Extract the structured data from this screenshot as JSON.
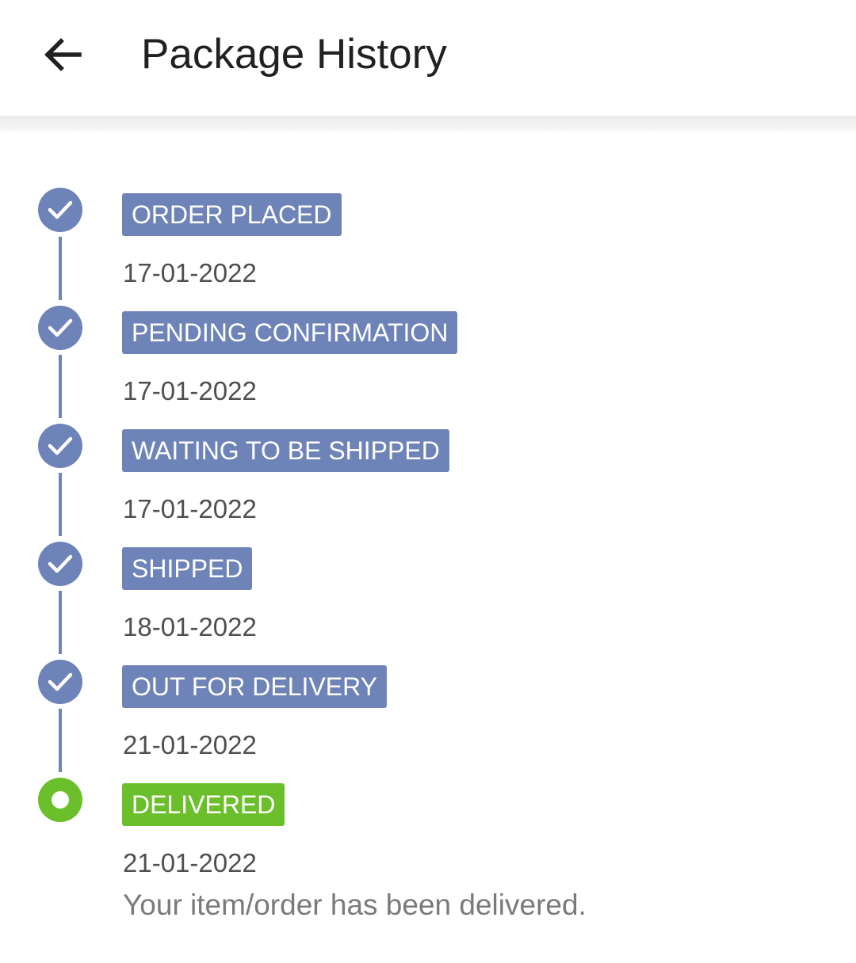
{
  "app_bar": {
    "title": "Package History",
    "back_icon": "arrow-left-icon"
  },
  "colors": {
    "done": "#6e83b8",
    "current": "#6abf2a",
    "title_text": "#212121",
    "date_text": "#4f4f4f",
    "note_text": "#7a7a7a"
  },
  "timeline": {
    "steps": [
      {
        "status": "ORDER PLACED",
        "date": "17-01-2022",
        "state": "done",
        "icon": "check-icon"
      },
      {
        "status": "PENDING CONFIRMATION",
        "date": "17-01-2022",
        "state": "done",
        "icon": "check-icon"
      },
      {
        "status": "WAITING TO BE SHIPPED",
        "date": "17-01-2022",
        "state": "done",
        "icon": "check-icon"
      },
      {
        "status": "SHIPPED",
        "date": "18-01-2022",
        "state": "done",
        "icon": "check-icon"
      },
      {
        "status": "OUT FOR DELIVERY",
        "date": "21-01-2022",
        "state": "done",
        "icon": "check-icon"
      },
      {
        "status": "DELIVERED",
        "date": "21-01-2022",
        "state": "current",
        "icon": "current-dot-icon"
      }
    ],
    "final_note": "Your item/order has been delivered."
  }
}
